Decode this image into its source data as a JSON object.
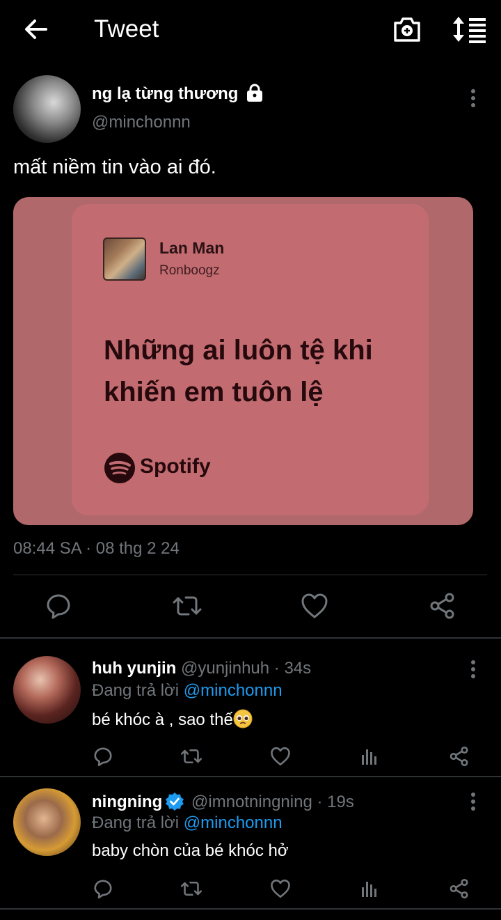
{
  "header": {
    "title": "Tweet"
  },
  "tweet": {
    "author_name": "ng lạ từng thương",
    "author_handle": "@minchonnn",
    "text": "mất niềm tin vào ai đó.",
    "timestamp": "08:44 SA · 08 thg 2 24",
    "media": {
      "song_title": "Lan Man",
      "song_artist": "Ronboogz",
      "lyrics": "Những ai luôn tệ khi khiến em tuôn lệ",
      "brand": "Spotify"
    }
  },
  "replies": [
    {
      "name": "huh yunjin",
      "meta": "@yunjinhuh · 34s",
      "replying_prefix": "Đang trả lời",
      "replying_to": "@minchonnn",
      "text": "bé khóc à , sao thế",
      "verified": false
    },
    {
      "name": "ningning",
      "meta": "@imnotningning · 19s",
      "replying_prefix": "Đang trả lời",
      "replying_to": "@minchonnn",
      "text": "baby chòn của bé khóc hở",
      "verified": true
    }
  ],
  "colors": {
    "accent": "#1d9bf0",
    "media_bg": "#b1686b",
    "card_bg": "#c26c71"
  }
}
